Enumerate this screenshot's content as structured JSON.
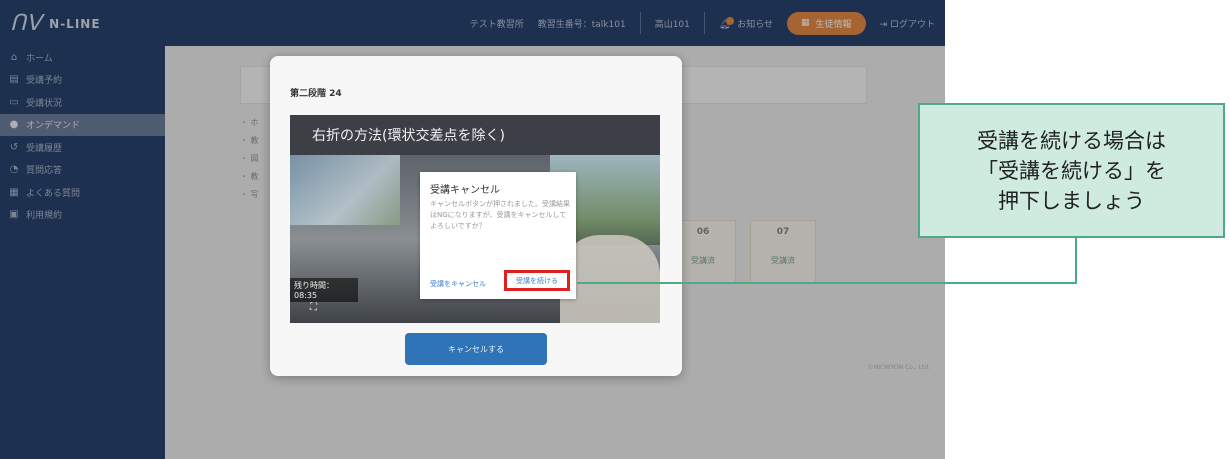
{
  "app": {
    "logo_text": "N-LINE",
    "logo_mark": "ꟽ"
  },
  "topbar": {
    "user_org": "テスト教習所",
    "student_no": "教習生番号：talk101",
    "user_name": "高山101",
    "notice_label": "お知らせ",
    "orange_label": "生徒情報",
    "logout_label": "ログアウト"
  },
  "sidebar": {
    "items": [
      {
        "icon": "⌂",
        "label": "ホーム"
      },
      {
        "icon": "▤",
        "label": "受講予約"
      },
      {
        "icon": "▭",
        "label": "受講状況"
      },
      {
        "icon": "●",
        "label": "オンデマンド"
      },
      {
        "icon": "↺",
        "label": "受講履歴"
      },
      {
        "icon": "◔",
        "label": "質問応答"
      },
      {
        "icon": "▦",
        "label": "よくある質問"
      },
      {
        "icon": "▣",
        "label": "利用規約"
      }
    ]
  },
  "background": {
    "bullets": [
      "・ ホ",
      "・ 教",
      "・ 図",
      "・ 教",
      "・ 写"
    ],
    "cells": [
      {
        "num": "06",
        "status": "受講済"
      },
      {
        "num": "07",
        "status": "受講済"
      }
    ],
    "copyright": "©NICHIYON Co., Ltd."
  },
  "modal": {
    "title": "第二段階 24",
    "video_title": "右折の方法(環状交差点を除く)",
    "remaining": "残り時間：08:35",
    "expand_icon": "⛶",
    "cancel_button": "キャンセルする"
  },
  "dialog": {
    "title": "受講キャンセル",
    "body": "キャンセルボタンが押されました。受講結果はNGになりますが、受講をキャンセルしてよろしいですか？",
    "cancel_label": "受講をキャンセル",
    "continue_label": "受講を続ける"
  },
  "callout": {
    "text": "受講を続ける場合は\n「受講を続ける」を\n押下しましょう"
  },
  "colors": {
    "navy": "#0e2a5a",
    "accent_orange": "#e07a2e",
    "button_blue": "#2f74b7",
    "highlight_red": "#e01f1f",
    "callout_green": "#4daa86"
  }
}
